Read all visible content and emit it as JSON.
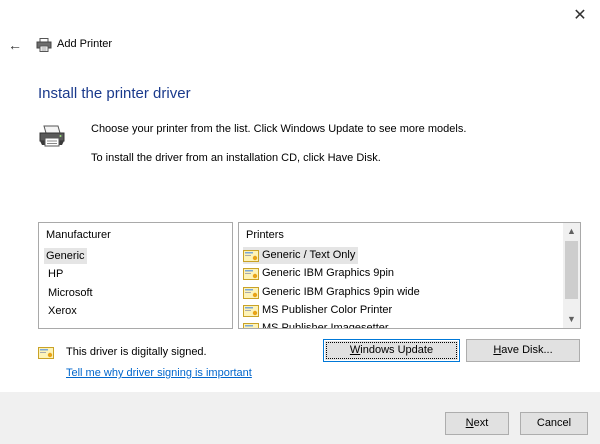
{
  "window": {
    "title": "Add Printer"
  },
  "heading": "Install the printer driver",
  "description": {
    "line1": "Choose your printer from the list. Click Windows Update to see more models.",
    "line2": "To install the driver from an installation CD, click Have Disk."
  },
  "manufacturers": {
    "header": "Manufacturer",
    "items": [
      "Generic",
      "HP",
      "Microsoft",
      "Xerox"
    ],
    "selected": "Generic"
  },
  "printers": {
    "header": "Printers",
    "items": [
      "Generic / Text Only",
      "Generic IBM Graphics 9pin",
      "Generic IBM Graphics 9pin wide",
      "MS Publisher Color Printer",
      "MS Publisher Imagesetter"
    ],
    "selected": "Generic / Text Only"
  },
  "buttons": {
    "windows_update_accel": "W",
    "windows_update_rest": "indows Update",
    "have_disk_accel": "H",
    "have_disk_rest": "ave Disk...",
    "next_accel": "N",
    "next_rest": "ext",
    "cancel": "Cancel"
  },
  "signing": {
    "status": "This driver is digitally signed.",
    "link": "Tell me why driver signing is important"
  },
  "icons": {
    "close": "close-icon",
    "back": "back-arrow-icon",
    "printer": "printer-icon",
    "driver": "driver-certificate-icon"
  },
  "colors": {
    "heading": "#1a3a8c",
    "link": "#0066cc",
    "footer_bg": "#f0f0f0",
    "selection": "#e5e5e5",
    "focus_border": "#0078d7"
  }
}
